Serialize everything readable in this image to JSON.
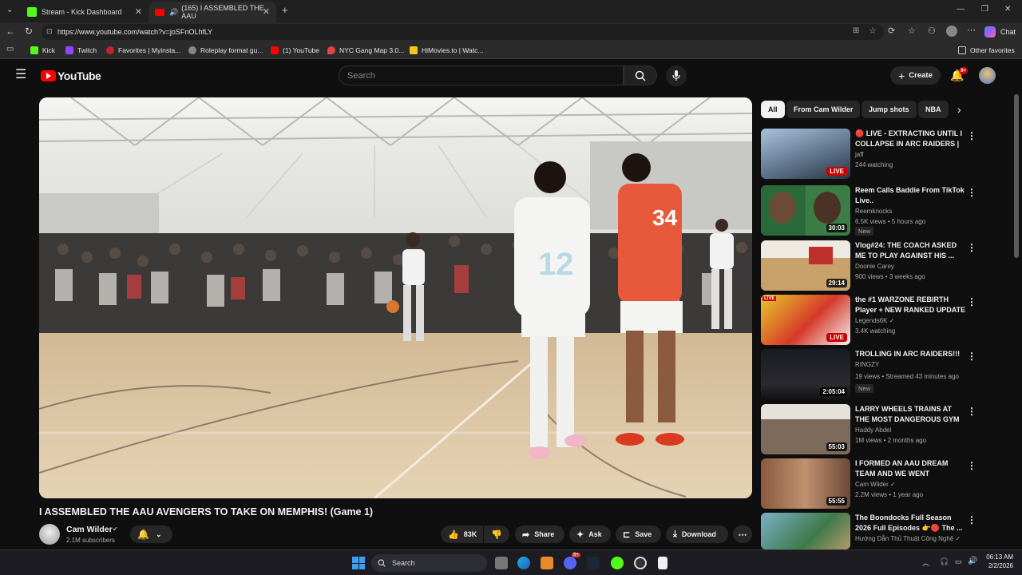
{
  "browser": {
    "tabs": [
      {
        "label": "Stream - Kick Dashboard",
        "active": false
      },
      {
        "label": "(165) I ASSEMBLED THE AAU",
        "active": true
      }
    ],
    "url": "https://www.youtube.com/watch?v=joSFnOLhfLY",
    "chat_label": "Chat",
    "bookmarks": [
      "Kick",
      "Twitch",
      "Favorites | Myinsta...",
      "Roleplay format gu...",
      "(1) YouTube",
      "NYC Gang Map 3.0...",
      "HiMovies.to | Watc..."
    ],
    "other_favorites": "Other favorites"
  },
  "youtube": {
    "logo_text": "YouTube",
    "search_placeholder": "Search",
    "create_label": "Create",
    "notif_badge": "9+",
    "video_title": "I ASSEMBLED THE AAU AVENGERS TO TAKE ON MEMPHIS! (Game 1)",
    "channel_name": "Cam Wilder",
    "subscribers": "2.1M subscribers",
    "likes": "83K",
    "actions": {
      "share": "Share",
      "ask": "Ask",
      "save": "Save",
      "download": "Download"
    },
    "jersey_12": "12",
    "jersey_34": "34",
    "chips": [
      "All",
      "From Cam Wilder",
      "Jump shots",
      "NBA"
    ],
    "recommendations": [
      {
        "title": "🔴 LIVE - EXTRACTING UNTIL I COLLAPSE IN ARC RAIDERS | ...",
        "channel": "jaff",
        "meta": "244 watching",
        "badge": "LIVE",
        "is_new": ""
      },
      {
        "title": "Reem Calls Baddie From TikTok Live..",
        "channel": "Reemknocks",
        "meta": "6.5K views • 5 hours ago",
        "badge": "30:03",
        "is_new": "New"
      },
      {
        "title": "Vlog#24: THE COACH ASKED ME TO PLAY AGAINST HIS ...",
        "channel": "Doonie Carey",
        "meta": "900 views • 3 weeks ago",
        "badge": "29:14",
        "is_new": ""
      },
      {
        "title": "the #1 WARZONE REBIRTH Player + NEW RANKED UPDATE",
        "channel": "Legends6K ✓",
        "meta": "3.4K watching",
        "badge": "LIVE",
        "is_new": ""
      },
      {
        "title": "TROLLING IN ARC RAIDERS!!!",
        "channel": "RINGZY",
        "meta": "19 views • Streamed 43 minutes ago",
        "badge": "2:05:04",
        "is_new": "New"
      },
      {
        "title": "LARRY WHEELS TRAINS AT THE MOST DANGEROUS GYM ...",
        "channel": "Haddy Abdel",
        "meta": "1M views • 2 months ago",
        "badge": "55:03",
        "is_new": ""
      },
      {
        "title": "I FORMED AN AAU DREAM TEAM AND WE WENT INSANE!...",
        "channel": "Cam Wilder ✓",
        "meta": "2.2M views • 1 year ago",
        "badge": "55:55",
        "is_new": ""
      },
      {
        "title": "The Boondocks Full Season 2026 Full Episodes 👉🔴 The ...",
        "channel": "Hướng Dẫn Thủ Thuật Công Nghệ ✓",
        "meta": "",
        "badge": "",
        "is_new": ""
      }
    ]
  },
  "taskbar": {
    "search_label": "Search",
    "time": "06:13 AM",
    "date": "2/2/2026",
    "discord_badge": "9+"
  },
  "colors": {
    "yt_red": "#ff0000",
    "live_red": "#cc0000",
    "bg": "#0f0f0f",
    "chip_bg": "#272727"
  }
}
